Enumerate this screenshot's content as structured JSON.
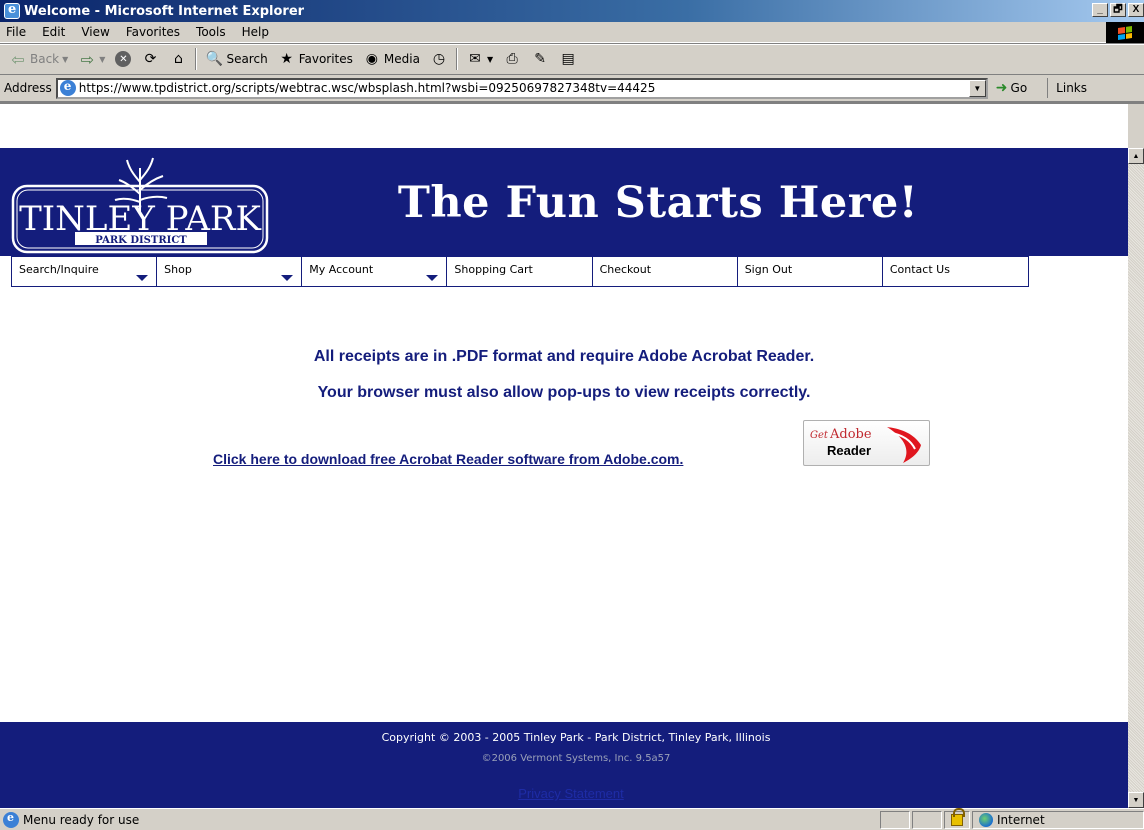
{
  "window": {
    "title": "Welcome - Microsoft Internet Explorer",
    "buttons": [
      "_",
      "🗗",
      "X"
    ]
  },
  "menubar": {
    "items": [
      "File",
      "Edit",
      "View",
      "Favorites",
      "Tools",
      "Help"
    ]
  },
  "toolbar": {
    "back_label": "Back",
    "search_label": "Search",
    "favorites_label": "Favorites",
    "media_label": "Media"
  },
  "addressbar": {
    "label": "Address",
    "url": "https://www.tpdistrict.org/scripts/webtrac.wsc/wbsplash.html?wsbi=09250697827348tv=44425",
    "go_label": "Go",
    "links_label": "Links"
  },
  "page": {
    "logo": {
      "name": "TINLEY PARK",
      "sub": "PARK DISTRICT"
    },
    "tagline": "The Fun Starts Here!",
    "nav": [
      {
        "label": "Search/Inquire",
        "has_menu": true
      },
      {
        "label": "Shop",
        "has_menu": true
      },
      {
        "label": "My Account",
        "has_menu": true
      },
      {
        "label": "Shopping Cart",
        "has_menu": false
      },
      {
        "label": "Checkout",
        "has_menu": false
      },
      {
        "label": "Sign Out",
        "has_menu": false
      },
      {
        "label": "Contact Us",
        "has_menu": false
      }
    ],
    "message_line1": "All receipts are in .PDF format and require Adobe Acrobat Reader.",
    "message_line2": "Your browser must also allow pop-ups to view receipts correctly.",
    "download_link": "Click here to download free Acrobat Reader software from Adobe.com.",
    "adobe_badge": {
      "get": "Get",
      "adobe": "Adobe",
      "reader": "Reader"
    },
    "footer": {
      "copyright": "Copyright © 2003 - 2005 Tinley Park - Park District, Tinley Park, Illinois",
      "vermont": "©2006 Vermont Systems, Inc. 9.5a57",
      "privacy": "Privacy Statement"
    }
  },
  "statusbar": {
    "text": "Menu ready for use",
    "zone": "Internet"
  },
  "colors": {
    "brand_navy": "#141d7c",
    "link": "#141d7c"
  }
}
